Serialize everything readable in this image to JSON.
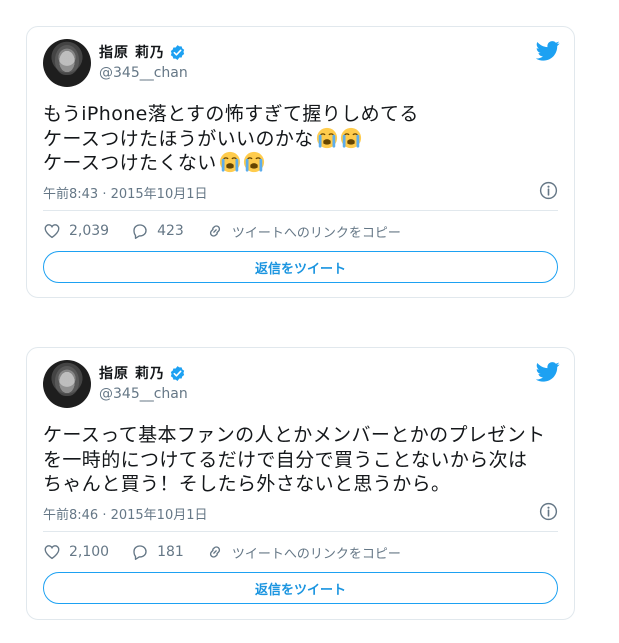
{
  "colors": {
    "brand_blue": "#1da1f2",
    "border": "#e1e8ed",
    "secondary_text": "#657786",
    "primary_text": "#14171a"
  },
  "icons": {
    "twitter": "twitter-bird-icon",
    "verified": "verified-badge-icon",
    "info": "info-icon",
    "like": "heart-icon",
    "reply": "reply-bubble-icon",
    "link": "link-icon",
    "emoji": "loudly-crying-face-emoji"
  },
  "tweets": [
    {
      "display_name": "指原 莉乃",
      "handle": "@345__chan",
      "text_lines": [
        "もうiPhone落とすの怖すぎて握りしめてる",
        "ケースつけたほうがいいのかな",
        "ケースつけたくない"
      ],
      "timestamp": "午前8:43 · 2015年10月1日",
      "likes": "2,039",
      "replies": "423",
      "copy_link_label": "ツイートへのリンクをコピー",
      "reply_button_label": "返信をツイート"
    },
    {
      "display_name": "指原 莉乃",
      "handle": "@345__chan",
      "text_lines": [
        "ケースって基本ファンの人とかメンバーとかのプレゼント",
        "を一時的につけてるだけで自分で買うことないから次は",
        "ちゃんと買う！そしたら外さないと思うから。"
      ],
      "timestamp": "午前8:46 · 2015年10月1日",
      "likes": "2,100",
      "replies": "181",
      "copy_link_label": "ツイートへのリンクをコピー",
      "reply_button_label": "返信をツイート"
    }
  ]
}
